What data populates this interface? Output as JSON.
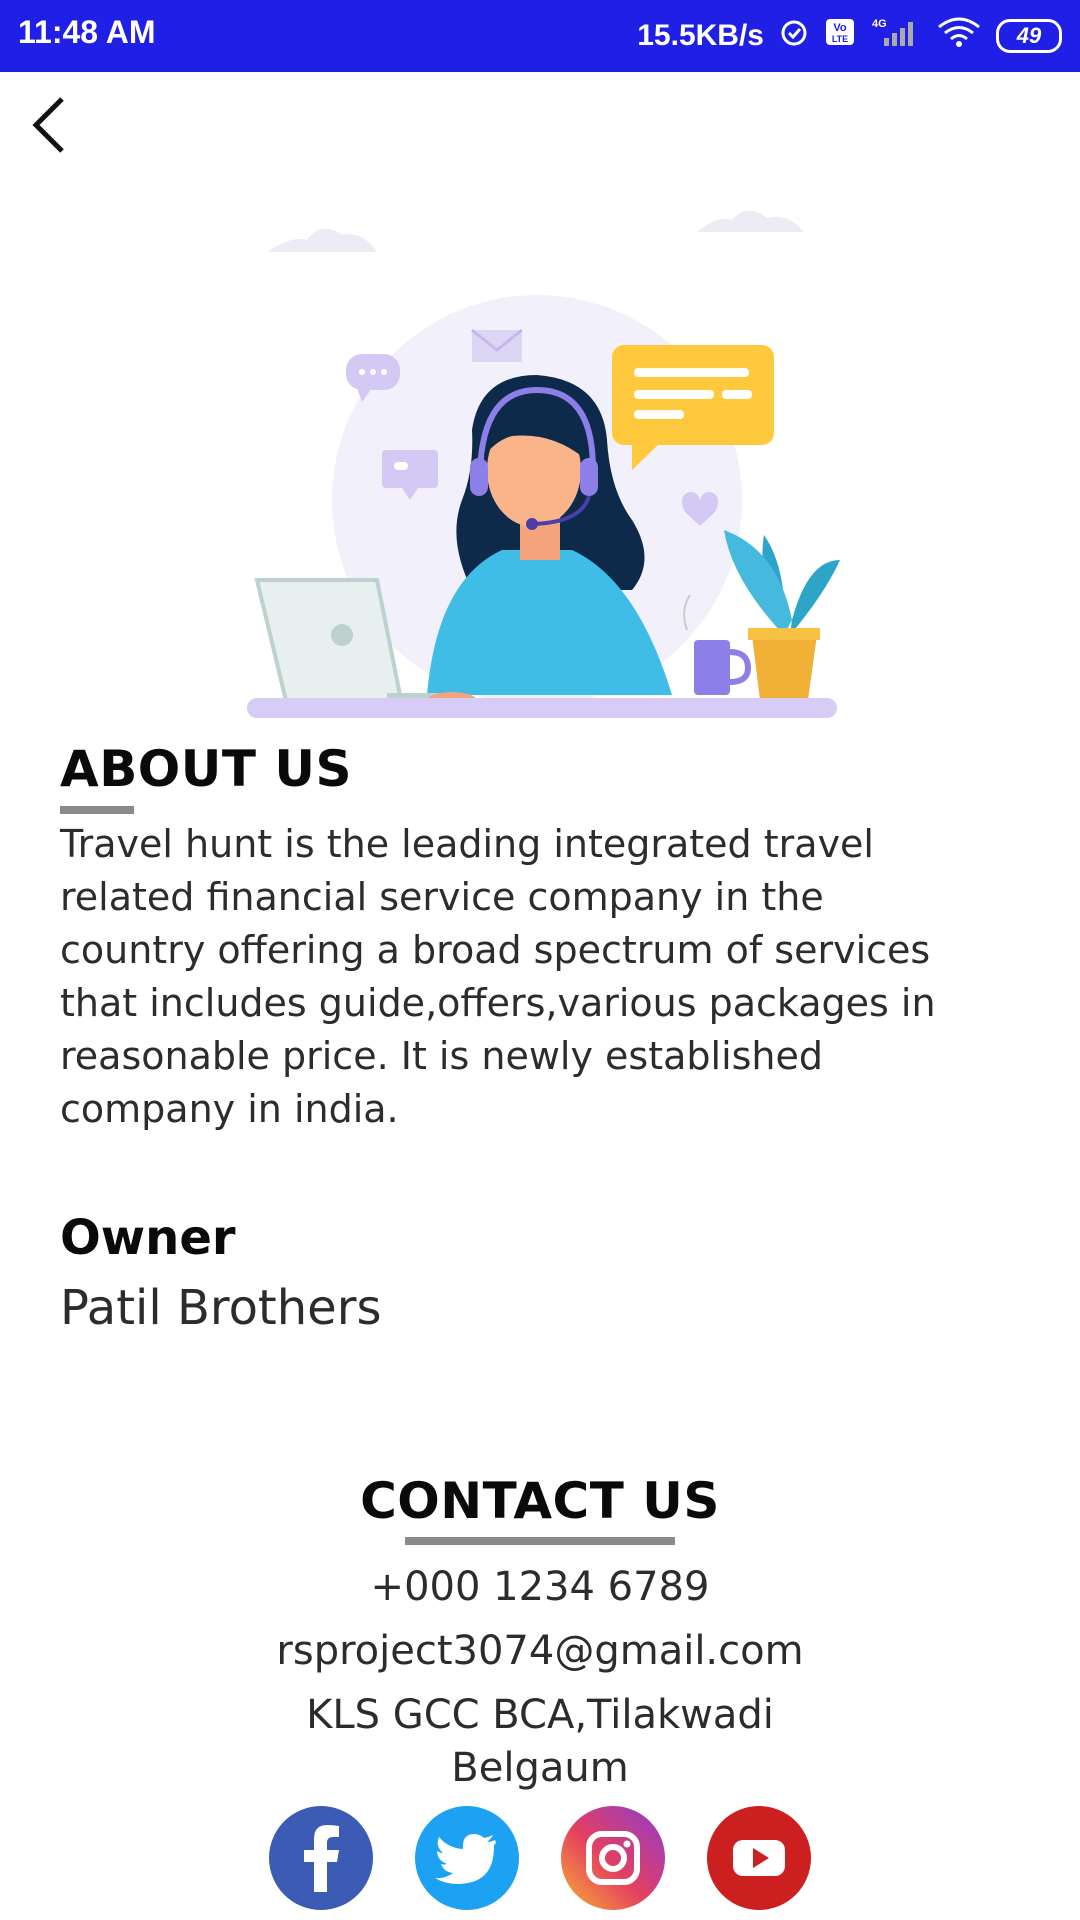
{
  "status_bar": {
    "time": "11:48 AM",
    "net_speed": "15.5KB/s",
    "battery": "49",
    "icons": [
      "alarm-icon",
      "volte-icon",
      "signal-4g-icon",
      "wifi-icon",
      "battery-icon"
    ]
  },
  "header": {
    "back_icon": "chevron-left-icon"
  },
  "hero": {
    "illustration": "customer-support-agent-illustration"
  },
  "about": {
    "title": "ABOUT US",
    "body": "Travel hunt is the leading integrated travel related financial service company in the country offering a broad spectrum of services that includes guide,offers,various packages in reasonable price. It is newly established company in india.",
    "owner_label": "Owner",
    "owner_value": "Patil Brothers"
  },
  "contact": {
    "title": "CONTACT US",
    "phone": "+000 1234 6789",
    "email": "rsproject3074@gmail.com",
    "address_line1": "KLS GCC BCA,Tilakwadi",
    "address_line2": "Belgaum"
  },
  "social": {
    "items": [
      {
        "name": "facebook",
        "icon": "facebook-icon",
        "color": "#3b5bb5"
      },
      {
        "name": "twitter",
        "icon": "twitter-icon",
        "color": "#1da1f2"
      },
      {
        "name": "instagram",
        "icon": "instagram-icon",
        "color": "#c13584"
      },
      {
        "name": "youtube",
        "icon": "youtube-icon",
        "color": "#cc1f1f"
      }
    ]
  },
  "colors": {
    "status_bar": "#1f1fe6",
    "underline": "#8a8a8a"
  }
}
